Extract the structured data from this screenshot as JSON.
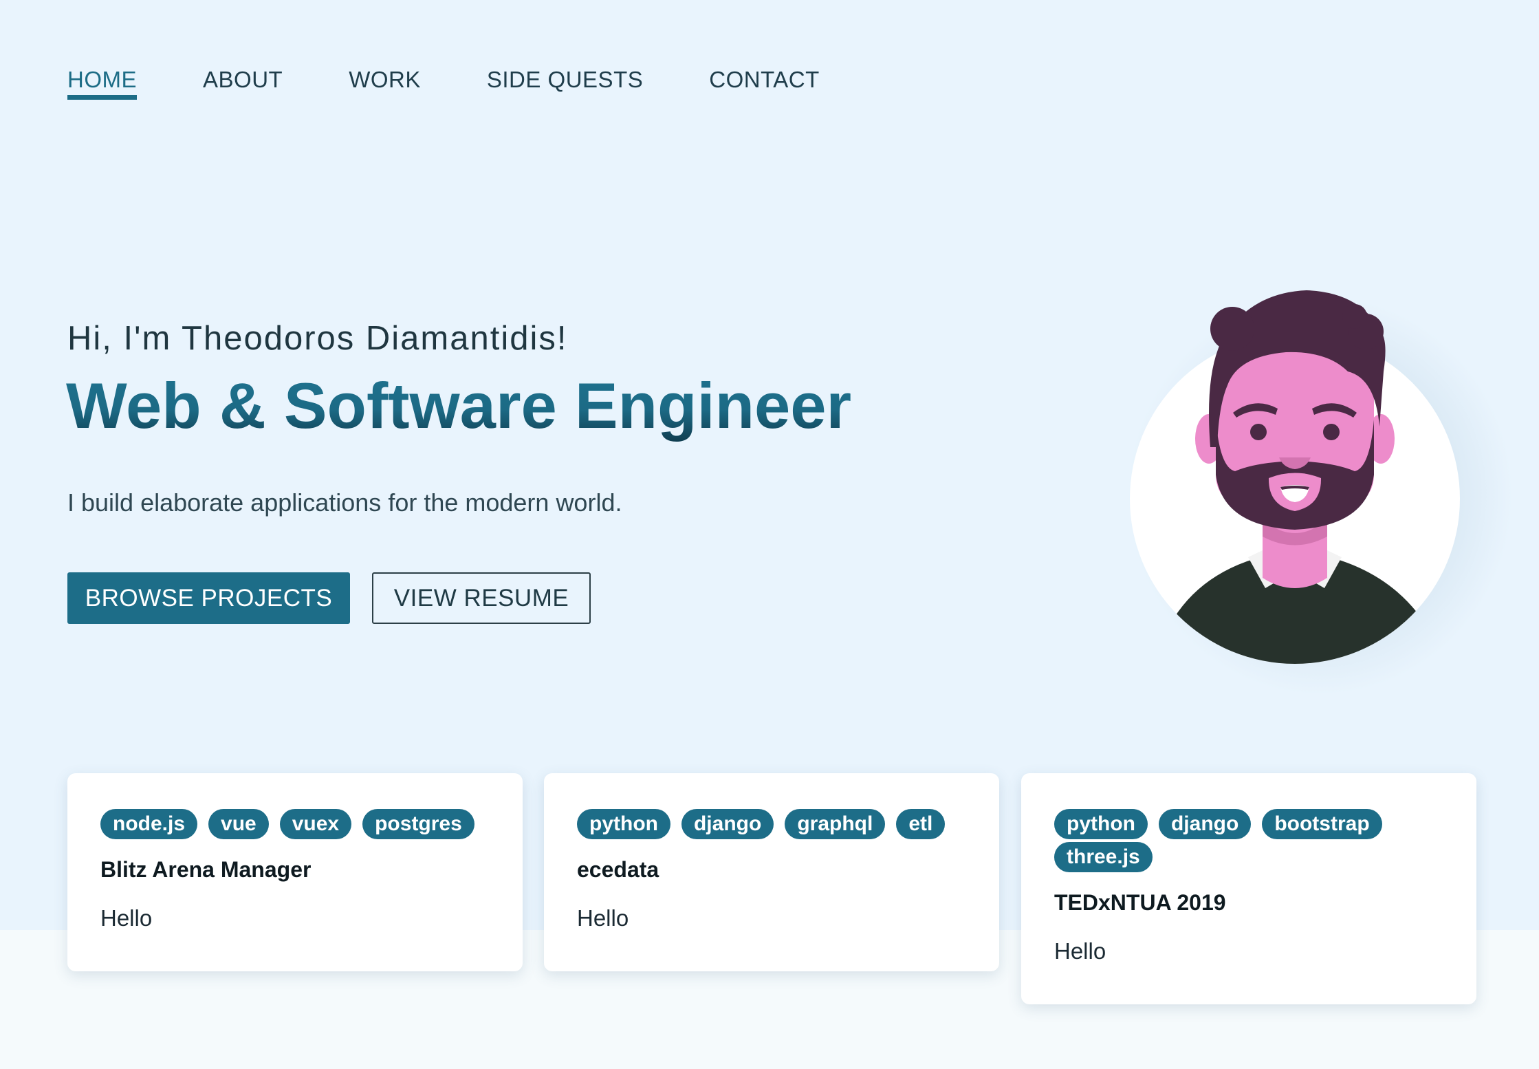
{
  "nav": {
    "items": [
      {
        "label": "HOME",
        "active": true
      },
      {
        "label": "ABOUT",
        "active": false
      },
      {
        "label": "WORK",
        "active": false
      },
      {
        "label": "SIDE QUESTS",
        "active": false
      },
      {
        "label": "CONTACT",
        "active": false
      }
    ]
  },
  "hero": {
    "greeting": "Hi, I'm Theodoros Diamantidis!",
    "headline": "Web & Software Engineer",
    "tagline": "I build elaborate applications for the modern world.",
    "primary_button": "BROWSE PROJECTS",
    "secondary_button": "VIEW RESUME"
  },
  "projects": [
    {
      "tags": [
        "node.js",
        "vue",
        "vuex",
        "postgres"
      ],
      "title": "Blitz Arena Manager",
      "description": "Hello"
    },
    {
      "tags": [
        "python",
        "django",
        "graphql",
        "etl"
      ],
      "title": "ecedata",
      "description": "Hello"
    },
    {
      "tags": [
        "python",
        "django",
        "bootstrap",
        "three.js"
      ],
      "title": "TEDxNTUA 2019",
      "description": "Hello"
    }
  ],
  "colors": {
    "accent": "#1d6d88",
    "hero_background": "#e9f4fd",
    "page_background": "#f5fafc",
    "avatar_skin": "#ed8ccb",
    "avatar_hair": "#4a2944",
    "avatar_shirt": "#27322c"
  },
  "icons": {
    "avatar": "bearded-man-avatar-illustration"
  }
}
